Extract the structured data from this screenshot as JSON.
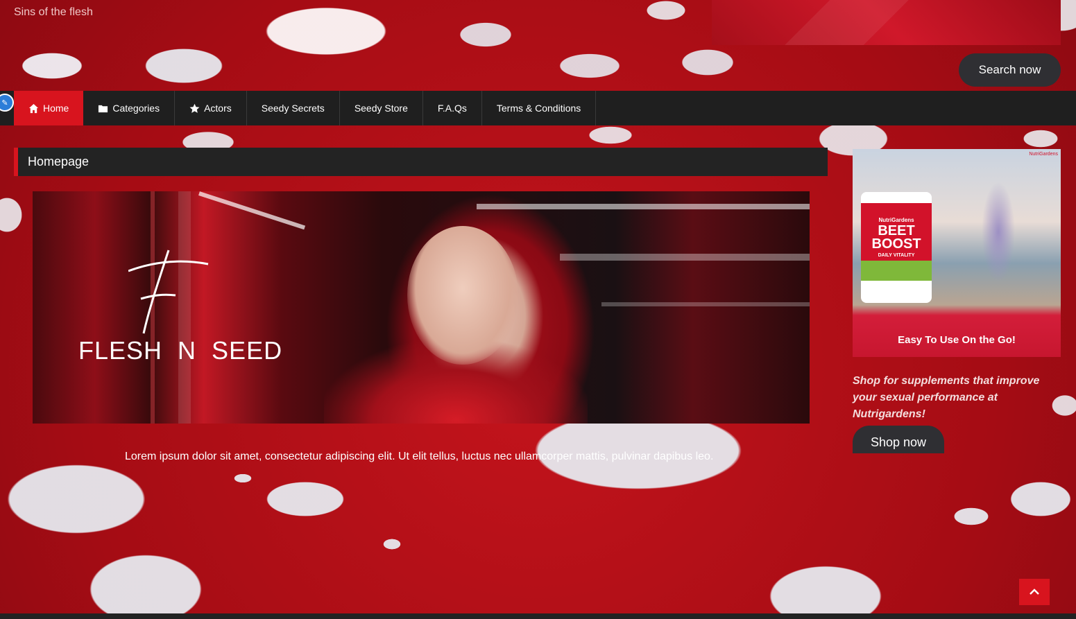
{
  "site": {
    "title": "Sins of the flesh"
  },
  "header": {
    "search_label": "Search now"
  },
  "nav": {
    "items": [
      {
        "label": "Home",
        "icon": "home-icon",
        "active": true
      },
      {
        "label": "Categories",
        "icon": "folder-icon"
      },
      {
        "label": "Actors",
        "icon": "star-icon"
      },
      {
        "label": "Seedy Secrets"
      },
      {
        "label": "Seedy Store"
      },
      {
        "label": "F.A.Qs"
      },
      {
        "label": "Terms & Conditions"
      }
    ]
  },
  "main": {
    "page_title": "Homepage",
    "hero": {
      "logo_text": "FLESH  N  SEED"
    },
    "body_text": "Lorem ipsum dolor sit amet, consectetur adipiscing elit. Ut elit tellus, luctus nec ullamcorper mattis, pulvinar dapibus leo."
  },
  "sidebar": {
    "ad": {
      "brand": "NutriGardens",
      "product_line1": "BEET",
      "product_line2": "BOOST",
      "tagline": "DAILY VITALITY",
      "caption": "Easy To Use On the Go!"
    },
    "promo_text": "Shop for supplements that improve your sexual performance at Nutrigardens!",
    "shop_label": "Shop now"
  },
  "colors": {
    "accent": "#d8141e",
    "nav_bg": "#1f1f1f",
    "button_bg": "#2f2f33"
  }
}
